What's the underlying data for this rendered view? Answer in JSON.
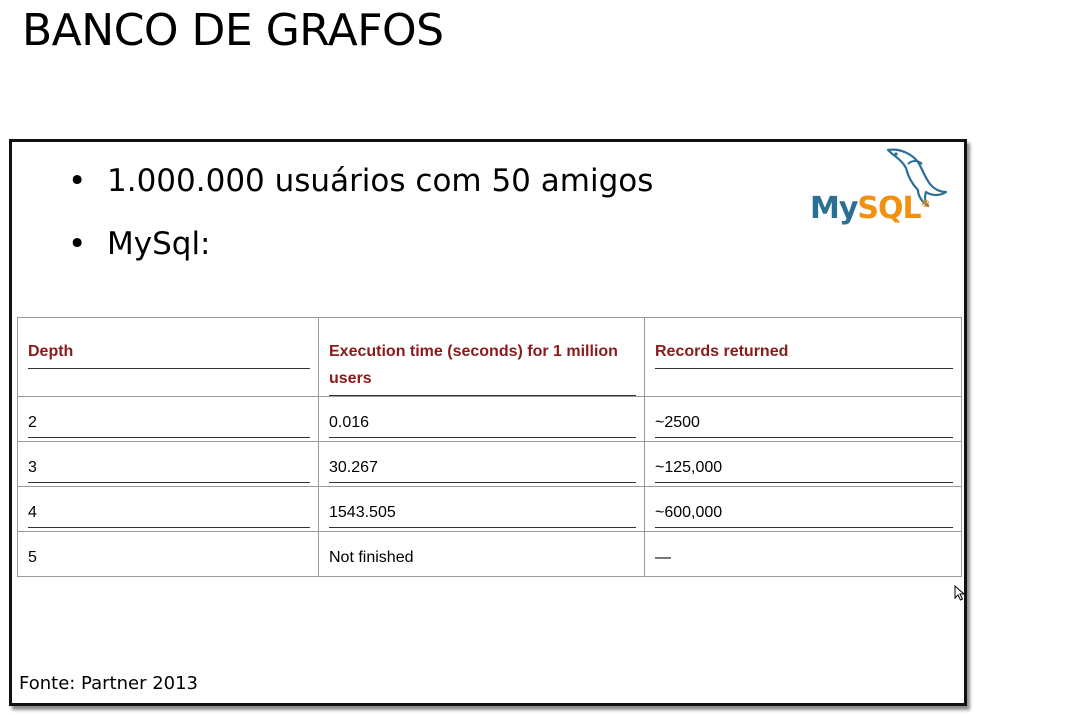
{
  "slide": {
    "title": "BANCO DE GRAFOS"
  },
  "bullets": [
    {
      "text": "1.000.000 usuários com 50 amigos"
    },
    {
      "text": "MySql:"
    }
  ],
  "logo": {
    "my": "My",
    "sql": "SQL",
    "reg": "®",
    "icon": "dolphin-icon",
    "colors": {
      "my": "#2c6f94",
      "sql": "#f29111"
    }
  },
  "table": {
    "header_color": "#8b1a1a",
    "headers": [
      "Depth",
      "Execution time (seconds) for 1 million users",
      "Records returned"
    ],
    "rows": [
      [
        "2",
        "0.016",
        "~2500"
      ],
      [
        "3",
        "30.267",
        "~125,000"
      ],
      [
        "4",
        "1543.505",
        "~600,000"
      ],
      [
        "5",
        "Not finished",
        "—"
      ]
    ]
  },
  "source": "Fonte: Partner 2013"
}
